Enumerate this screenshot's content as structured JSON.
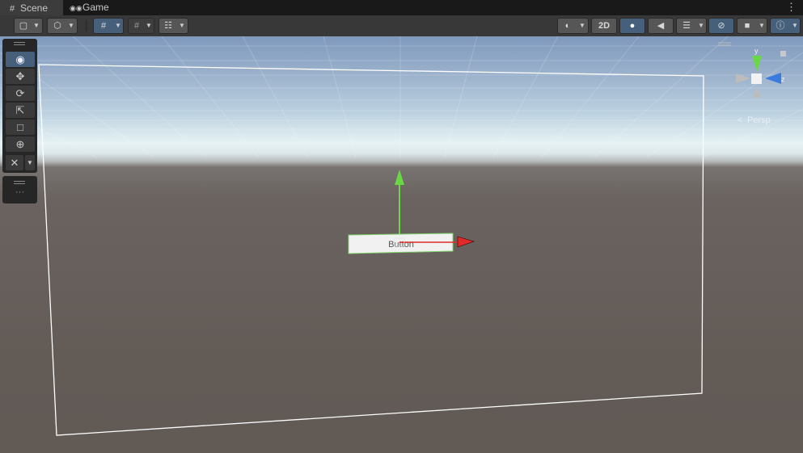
{
  "tabs": [
    {
      "label": "Scene",
      "icon": "grid-icon",
      "active": true
    },
    {
      "label": "Game",
      "icon": "gamepad-icon",
      "active": false
    }
  ],
  "toolbar": {
    "label_2d": "2D"
  },
  "scene": {
    "object_label": "Button",
    "gizmo_projection": "Persp",
    "axis_y": "y",
    "axis_z": "z"
  },
  "tools": [
    "view-tool",
    "move-tool",
    "rotate-tool",
    "scale-tool",
    "rect-tool",
    "transform-tool",
    "custom-tool"
  ],
  "colors": {
    "axis_x": "#e02a2a",
    "axis_y": "#6ad844",
    "axis_z": "#3b7be0",
    "selection": "#7ed36a",
    "accent": "#46607c"
  }
}
